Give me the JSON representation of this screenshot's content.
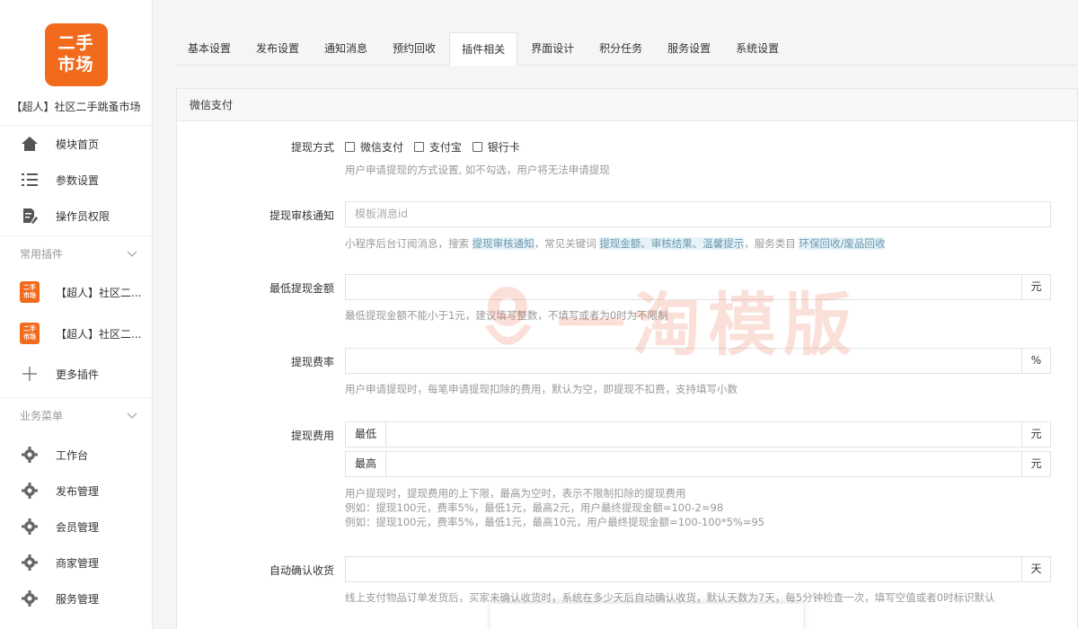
{
  "sidebar": {
    "logo_line1": "二手",
    "logo_line2": "市场",
    "app_name": "【超人】社区二手跳蚤市场",
    "main_items": [
      {
        "label": "模块首页",
        "icon": "home-icon"
      },
      {
        "label": "参数设置",
        "icon": "list-icon"
      },
      {
        "label": "操作员权限",
        "icon": "document-edit-icon"
      }
    ],
    "plugin_group_title": "常用插件",
    "plugins": [
      {
        "label": "【超人】社区二...",
        "thumb": "二手市场"
      },
      {
        "label": "【超人】社区二...",
        "thumb": "二手市场"
      }
    ],
    "more_plugins": "更多插件",
    "business_group_title": "业务菜单",
    "business_items": [
      {
        "label": "工作台"
      },
      {
        "label": "发布管理"
      },
      {
        "label": "会员管理"
      },
      {
        "label": "商家管理"
      },
      {
        "label": "服务管理"
      }
    ]
  },
  "tabs": [
    {
      "label": "基本设置",
      "active": false
    },
    {
      "label": "发布设置",
      "active": false
    },
    {
      "label": "通知消息",
      "active": false
    },
    {
      "label": "预约回收",
      "active": false
    },
    {
      "label": "插件相关",
      "active": true
    },
    {
      "label": "界面设计",
      "active": false
    },
    {
      "label": "积分任务",
      "active": false
    },
    {
      "label": "服务设置",
      "active": false
    },
    {
      "label": "系统设置",
      "active": false
    }
  ],
  "panel": {
    "title": "微信支付",
    "withdraw_method": {
      "label": "提现方式",
      "options": [
        "微信支付",
        "支付宝",
        "银行卡"
      ],
      "help": "用户申请提现的方式设置, 如不勾选，用户将无法申请提现"
    },
    "audit_notice": {
      "label": "提现审核通知",
      "placeholder": "模板消息id",
      "help_a": "小程序后台订阅消息，搜索 ",
      "help_hl1": "提现审核通知",
      "help_b": "，常见关键词 ",
      "help_hl2": "提现金额、审核结果、温馨提示",
      "help_c": "，服务类目 ",
      "help_hl3": "环保回收/废品回收"
    },
    "min_amount": {
      "label": "最低提现金额",
      "unit": "元",
      "help": "最低提现金额不能小于1元，建议填写整数，不填写或者为0时为不限制"
    },
    "fee_rate": {
      "label": "提现费率",
      "unit": "%",
      "help": "用户申请提现时，每笔申请提现扣除的费用，默认为空，即提现不扣费，支持填写小数"
    },
    "fee_amount": {
      "label": "提现费用",
      "min_prefix": "最低",
      "max_prefix": "最高",
      "unit": "元",
      "help1": "用户提现时，提现费用的上下限，最高为空时，表示不限制扣除的提现费用",
      "help2": "例如：提现100元，费率5%，最低1元，最高2元，用户最终提现金额=100-2=98",
      "help3": "例如：提现100元，费率5%，最低1元，最高10元，用户最终提现金额=100-100*5%=95"
    },
    "auto_confirm": {
      "label": "自动确认收货",
      "unit": "天",
      "help": "线上支付物品订单发货后，买家未确认收货时，系统在多少天后自动确认收货，默认天数为7天，每5分钟检查一次，填写空值或者0时标识默认"
    }
  },
  "watermark": {
    "text": "一淘模版"
  },
  "colors": {
    "brand": "#f26b1d",
    "highlight_bg": "#e6f2f7",
    "highlight_text": "#6a98b0"
  }
}
